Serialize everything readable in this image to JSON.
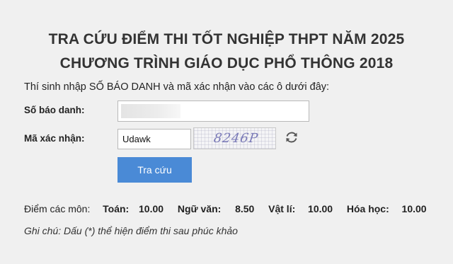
{
  "header": {
    "title_line1": "TRA CỨU ĐIỂM THI TỐT NGHIỆP THPT NĂM 2025",
    "title_line2": "CHƯƠNG TRÌNH GIÁO DỤC PHỔ THÔNG 2018"
  },
  "form": {
    "instruction": "Thí sinh nhập SỐ BÁO DANH và mã xác nhận vào các ô dưới đây:",
    "sbd_label": "Số báo danh:",
    "sbd_value": "",
    "captcha_label": "Mã xác nhận:",
    "captcha_value": "Udawk",
    "captcha_image_text": "8246P",
    "refresh_icon": "refresh-icon",
    "submit_label": "Tra cứu",
    "button_color": "#4a8ad6"
  },
  "results": {
    "label": "Điểm các môn:",
    "subjects": [
      {
        "name": "Toán:",
        "score": "10.00"
      },
      {
        "name": "Ngữ văn:",
        "score": "8.50"
      },
      {
        "name": "Vật lí:",
        "score": "10.00"
      },
      {
        "name": "Hóa học:",
        "score": "10.00"
      }
    ],
    "note": "Ghi chú: Dấu (*) thể hiện điểm thi sau phúc khảo"
  }
}
